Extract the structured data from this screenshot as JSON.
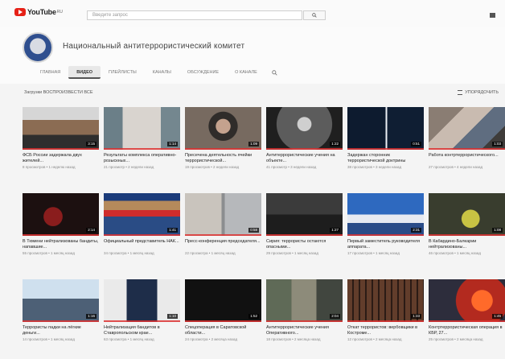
{
  "app": {
    "logo_text": "YouTube",
    "region": "RU",
    "search_placeholder": "Введите запрос"
  },
  "channel": {
    "name": "Национальный антитеррористический комитет"
  },
  "tabs": [
    {
      "label": "Главная",
      "active": false
    },
    {
      "label": "Видео",
      "active": true
    },
    {
      "label": "Плейлисты",
      "active": false
    },
    {
      "label": "Каналы",
      "active": false
    },
    {
      "label": "Обсуждение",
      "active": false
    },
    {
      "label": "О канале",
      "active": false
    }
  ],
  "filter": {
    "left": "Загрузки  ВОСПРОИЗВЕСТИ ВСЕ",
    "right": "УПОРЯДОЧИТЬ"
  },
  "videos": [
    {
      "title": "ФСБ России задержала двух жителей...",
      "meta": "8 просмотров • 1 неделю назад",
      "duration": "3:15"
    },
    {
      "title": "Результаты комплекса оперативно-розыскных...",
      "meta": "21 просмотр • 2 недели назад",
      "duration": "1:14"
    },
    {
      "title": "Пресечена деятельность ячейки террористической...",
      "meta": "19 просмотров • 2 недели назад",
      "duration": "1:09"
    },
    {
      "title": "Антитеррористические учения на объекте...",
      "meta": "41 просмотр • 3 недели назад",
      "duration": "1:22"
    },
    {
      "title": "Задержан сторонник террористической доктрины",
      "meta": "38 просмотров • 3 недели назад",
      "duration": "0:51"
    },
    {
      "title": "Работа контртеррористического...",
      "meta": "27 просмотров • 4 недели назад",
      "duration": "1:03"
    },
    {
      "title": "В Тюмени нейтрализованы бандиты, напавшие...",
      "meta": "55 просмотров • 1 месяц назад",
      "duration": "2:14"
    },
    {
      "title": "Официальный представитель НАК...",
      "meta": "34 просмотра • 1 месяц назад",
      "duration": "1:41"
    },
    {
      "title": "Пресс-конференция председателя...",
      "meta": "22 просмотра • 1 месяц назад",
      "duration": "0:58"
    },
    {
      "title": "Сирия: террористы остаются опасными...",
      "meta": "29 просмотров • 1 месяц назад",
      "duration": "1:27"
    },
    {
      "title": "Первый заместитель руководителя аппарата...",
      "meta": "17 просмотров • 1 месяц назад",
      "duration": "2:31"
    },
    {
      "title": "В Кабардино-Балкарии нейтрализованы...",
      "meta": "46 просмотров • 1 месяц назад",
      "duration": "1:08"
    },
    {
      "title": "Террористы падки на лёгкие деньги...",
      "meta": "14 просмотров • 1 месяц назад",
      "duration": "1:16"
    },
    {
      "title": "Нейтрализация бандитов в Ставропольском крае...",
      "meta": "63 просмотра • 1 месяц назад",
      "duration": "1:10"
    },
    {
      "title": "Спецоперация в Саратовской области...",
      "meta": "24 просмотра • 2 месяца назад",
      "duration": "1:52"
    },
    {
      "title": "Антитеррористические учения Оперативного...",
      "meta": "18 просмотров • 2 месяца назад",
      "duration": "2:04"
    },
    {
      "title": "Откат террористов: вербовщики в Костроме...",
      "meta": "12 просмотров • 2 месяца назад",
      "duration": "1:33"
    },
    {
      "title": "Контртеррористическая операция в КБР, 27...",
      "meta": "25 просмотров • 2 месяца назад",
      "duration": "1:45"
    }
  ]
}
